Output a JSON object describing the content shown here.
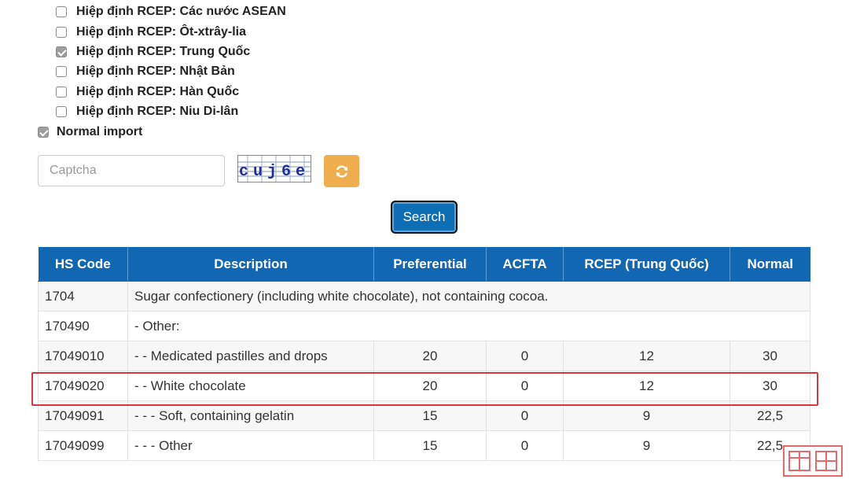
{
  "filters": [
    {
      "label": "Hiệp định RCEP: Các nước ASEAN",
      "checked": false
    },
    {
      "label": "Hiệp định RCEP: Ôt-xtrây-lia",
      "checked": false
    },
    {
      "label": "Hiệp định RCEP: Trung Quốc",
      "checked": true
    },
    {
      "label": "Hiệp định RCEP: Nhật Bản",
      "checked": false
    },
    {
      "label": "Hiệp định RCEP: Hàn Quốc",
      "checked": false
    },
    {
      "label": "Hiệp định RCEP: Niu Di-lân",
      "checked": false
    }
  ],
  "normal_import": {
    "label": "Normal import",
    "checked": true
  },
  "captcha": {
    "placeholder": "Captcha",
    "value": "",
    "code": "cuj6e"
  },
  "search_button": "Search",
  "table": {
    "headers": [
      "HS Code",
      "Description",
      "Preferential",
      "ACFTA",
      "RCEP (Trung Quốc)",
      "Normal"
    ],
    "rows": [
      {
        "code": "1704",
        "description": "Sugar confectionery (including white chocolate), not containing cocoa.",
        "preferential": "",
        "acfta": "",
        "rcep": "",
        "normal": ""
      },
      {
        "code": "170490",
        "description": "- Other:",
        "preferential": "",
        "acfta": "",
        "rcep": "",
        "normal": ""
      },
      {
        "code": "17049010",
        "description": "- - Medicated pastilles and drops",
        "preferential": "20",
        "acfta": "0",
        "rcep": "12",
        "normal": "30"
      },
      {
        "code": "17049020",
        "description": "- - White chocolate",
        "preferential": "20",
        "acfta": "0",
        "rcep": "12",
        "normal": "30"
      },
      {
        "code": "17049091",
        "description": "- - - Soft, containing gelatin",
        "preferential": "15",
        "acfta": "0",
        "rcep": "9",
        "normal": "22,5"
      },
      {
        "code": "17049099",
        "description": "- - - Other",
        "preferential": "15",
        "acfta": "0",
        "rcep": "9",
        "normal": "22,5"
      }
    ]
  },
  "colors": {
    "header_bg": "#1167b1",
    "link": "#1a6aad",
    "highlight_border": "#d93540",
    "refresh_bg": "#f0ad4e",
    "search_bg": "#0d6eb3"
  }
}
